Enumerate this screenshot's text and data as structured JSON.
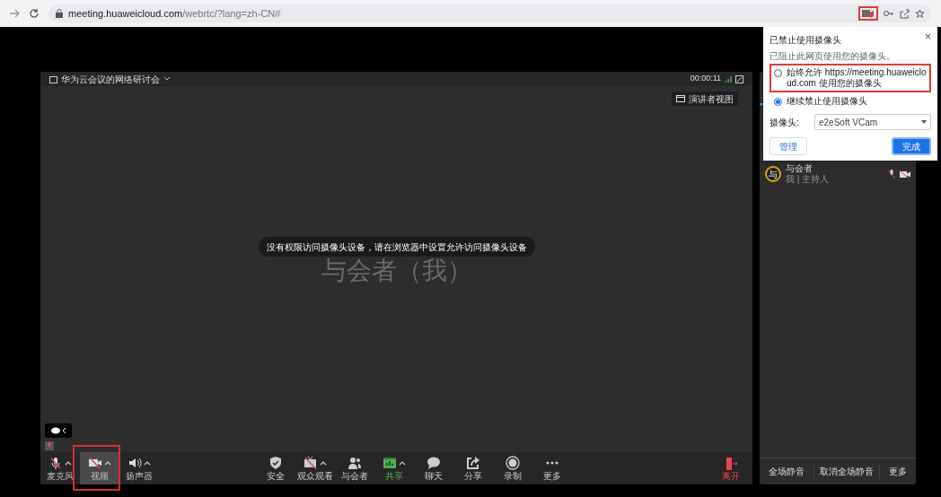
{
  "browser": {
    "url_host": "meeting.huaweicloud.com",
    "url_path": "/webrtc/?lang=zh-CN#"
  },
  "meeting": {
    "title": "华为云会议的网络研讨会",
    "timer": "00:00:11",
    "view_button": "演讲者视图",
    "self_name": "与会者（我）",
    "toast": "没有权限访问摄像头设备，请在浏览器中设置允许访问摄像头设备"
  },
  "toolbar_left": [
    {
      "kind": "mic",
      "label": "麦克风",
      "caret": true,
      "selected": false
    },
    {
      "kind": "camera",
      "label": "视频",
      "caret": true,
      "selected": true
    },
    {
      "kind": "speaker",
      "label": "扬声器",
      "caret": true,
      "selected": false
    }
  ],
  "toolbar_center": [
    {
      "kind": "shield",
      "label": "安全",
      "caret": false,
      "color": "#cccccc"
    },
    {
      "kind": "audience",
      "label": "观众观看",
      "caret": true,
      "color": "#cccccc"
    },
    {
      "kind": "people",
      "label": "与会者",
      "caret": false,
      "color": "#cccccc"
    },
    {
      "kind": "share-screen",
      "label": "共享",
      "caret": true,
      "color": "#4caf50"
    },
    {
      "kind": "chat",
      "label": "聊天",
      "caret": false,
      "color": "#cccccc"
    },
    {
      "kind": "share",
      "label": "分享",
      "caret": false,
      "color": "#cccccc"
    },
    {
      "kind": "record",
      "label": "录制",
      "caret": false,
      "color": "#cccccc"
    },
    {
      "kind": "more",
      "label": "更多",
      "caret": false,
      "color": "#cccccc"
    }
  ],
  "leave": {
    "label": "离开",
    "color": "#e5484d"
  },
  "participants": [
    {
      "avatar": "与",
      "name": "与会者",
      "role": "我 | 主持人",
      "mic_muted": true,
      "camera_off": true
    }
  ],
  "panel_buttons": [
    "全场静音",
    "取消全场静音",
    "更多"
  ],
  "popup": {
    "title": "已禁止使用摄像头",
    "close": "×",
    "subtitle": "已阻止此网页使用您的摄像头。",
    "options": [
      {
        "label": "始终允许 https://meeting.huaweicloud.com 使用您的摄像头",
        "selected": false
      },
      {
        "label": "继续禁止使用摄像头",
        "selected": true
      }
    ],
    "camera_label": "摄像头:",
    "camera_value": "e2eSoft VCam",
    "buttons": [
      {
        "label": "管理",
        "primary": false
      },
      {
        "label": "完成",
        "primary": true
      }
    ]
  }
}
